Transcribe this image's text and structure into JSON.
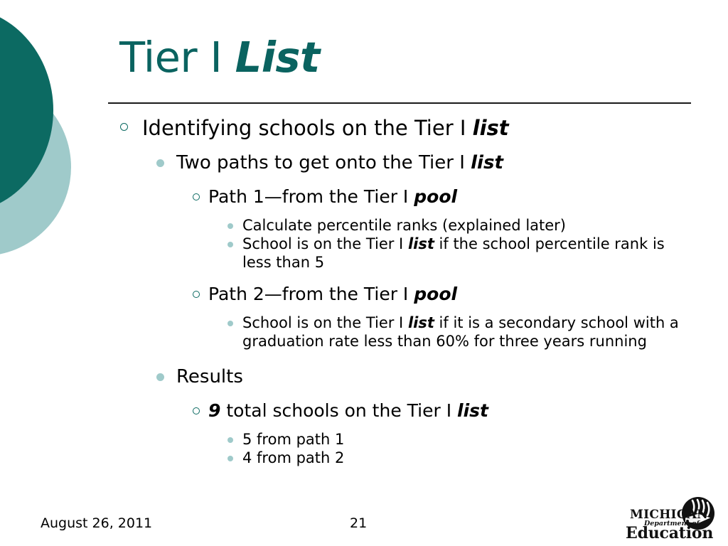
{
  "slide": {
    "title": {
      "plain": "Tier I ",
      "emphasis": "List"
    },
    "theme": {
      "dark_teal": "#0C6A62",
      "light_teal": "#9FCACA",
      "title_color": "#0A6360",
      "text_color": "#000000",
      "background": "#FFFFFF"
    },
    "outline": [
      {
        "level": 1,
        "bullet": "hollow-circle-bullet",
        "parts": [
          {
            "text": "Identifying schools on the Tier I ",
            "emphasis": false
          },
          {
            "text": "list",
            "emphasis": true
          }
        ]
      },
      {
        "level": 2,
        "bullet": "filled-dot-bullet",
        "parts": [
          {
            "text": "Two paths to get onto the Tier I ",
            "emphasis": false
          },
          {
            "text": "list",
            "emphasis": true
          }
        ]
      },
      {
        "level": 3,
        "bullet": "hollow-circle-bullet",
        "parts": [
          {
            "text": "Path 1—from the Tier I ",
            "emphasis": false
          },
          {
            "text": "pool",
            "emphasis": true
          }
        ]
      },
      {
        "level": 4,
        "bullet": "small-dot-bullet",
        "parts": [
          {
            "text": "Calculate percentile ranks (explained later)",
            "emphasis": false
          }
        ]
      },
      {
        "level": 4,
        "bullet": "small-dot-bullet",
        "parts": [
          {
            "text": "School is on the Tier I ",
            "emphasis": false
          },
          {
            "text": "list",
            "emphasis": true
          },
          {
            "text": " if the school percentile rank is less than 5",
            "emphasis": false
          }
        ]
      },
      {
        "level": 3,
        "bullet": "hollow-circle-bullet",
        "parts": [
          {
            "text": "Path 2—from the Tier I ",
            "emphasis": false
          },
          {
            "text": "pool",
            "emphasis": true
          }
        ]
      },
      {
        "level": 4,
        "bullet": "small-dot-bullet",
        "parts": [
          {
            "text": "School is on the Tier I ",
            "emphasis": false
          },
          {
            "text": "list",
            "emphasis": true
          },
          {
            "text": " if it is a secondary school with a graduation rate less than 60% for three years running",
            "emphasis": false
          }
        ]
      },
      {
        "level": 2,
        "bullet": "filled-dot-bullet",
        "parts": [
          {
            "text": "Results",
            "emphasis": false
          }
        ]
      },
      {
        "level": 3,
        "bullet": "hollow-circle-bullet",
        "parts": [
          {
            "text": "9",
            "emphasis": true
          },
          {
            "text": " total schools on the Tier I ",
            "emphasis": false
          },
          {
            "text": "list",
            "emphasis": true
          }
        ]
      },
      {
        "level": 4,
        "bullet": "small-dot-bullet",
        "parts": [
          {
            "text": "5 from path 1",
            "emphasis": false
          }
        ]
      },
      {
        "level": 4,
        "bullet": "small-dot-bullet",
        "parts": [
          {
            "text": "4 from path 2",
            "emphasis": false
          }
        ]
      }
    ],
    "footer": {
      "date": "August 26, 2011",
      "page_number": "21"
    },
    "logo": {
      "name": "michigan-department-of-education-logo",
      "line1": "MICHIGAN",
      "line2": "Department of",
      "line3": "Education"
    }
  }
}
